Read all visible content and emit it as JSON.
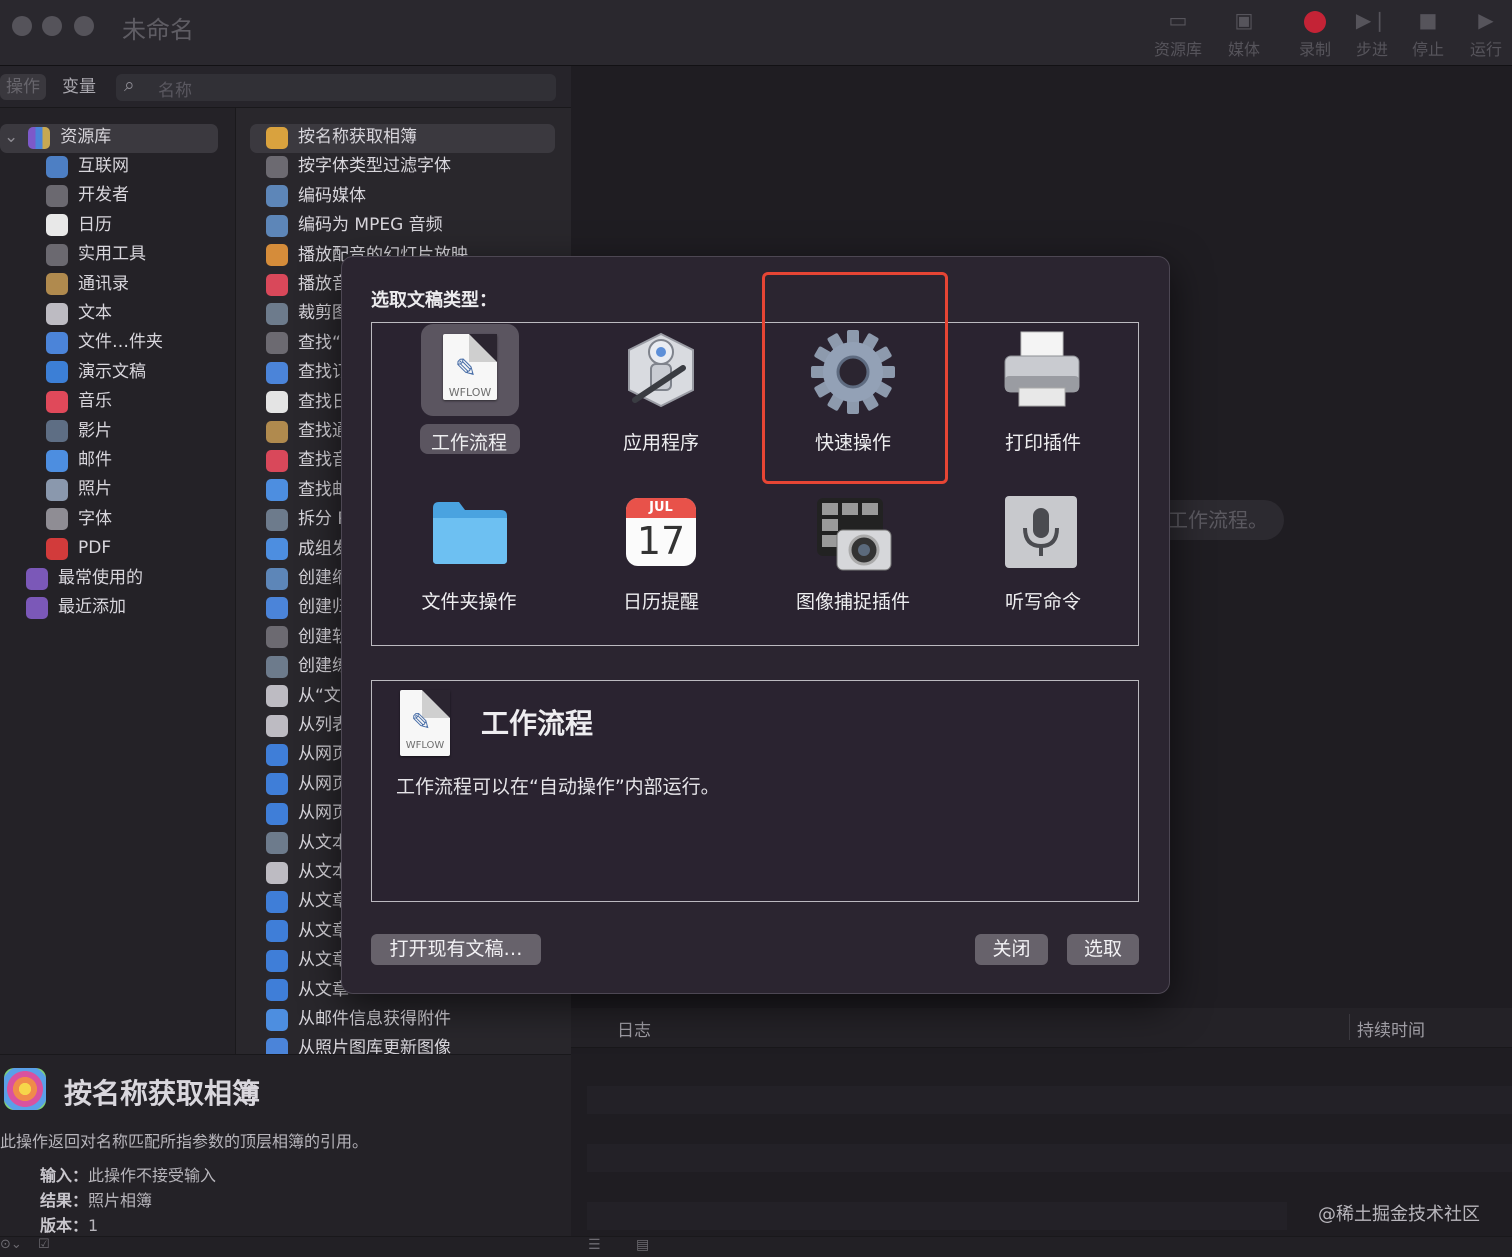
{
  "window": {
    "title": "未命名",
    "toolbar": [
      "资源库",
      "媒体",
      "录制",
      "步进",
      "停止",
      "运行"
    ],
    "colors": {
      "record": "#d7263d",
      "highlight": "#e64534"
    }
  },
  "left_tabs": {
    "actions": "操作",
    "variables": "变量",
    "search_placeholder": "名称"
  },
  "library": {
    "root": "资源库",
    "items": [
      "互联网",
      "开发者",
      "日历",
      "实用工具",
      "通讯录",
      "文本",
      "文件…件夹",
      "演示文稿",
      "音乐",
      "影片",
      "邮件",
      "照片",
      "字体",
      "PDF"
    ],
    "smart": [
      "最常使用的",
      "最近添加"
    ],
    "calendar_badge": "17"
  },
  "actions_list": [
    "按名称获取相簿",
    "按字体类型过滤字体",
    "编码媒体",
    "编码为 MPEG 音频",
    "播放配音的幻灯片放映",
    "播放音",
    "裁剪图",
    "查找“",
    "查找订",
    "查找日",
    "查找通",
    "查找音",
    "查找邮",
    "拆分 P",
    "成组发",
    "创建缩",
    "创建归",
    "创建软",
    "创建练",
    "从“文",
    "从列表",
    "从网页",
    "从网页",
    "从网页",
    "从文本",
    "从文本",
    "从文章",
    "从文章",
    "从文章",
    "从文章",
    "从邮件信息获得附件",
    "从照片图库更新图像"
  ],
  "info": {
    "title": "按名称获取相簿",
    "description": "此操作返回对名称匹配所指参数的顶层相簿的引用。",
    "input_label": "输入：",
    "input_value": "此操作不接受输入",
    "result_label": "结果：",
    "result_value": "照片相簿",
    "version_label": "版本：",
    "version_value": "1"
  },
  "canvas": {
    "hint": "工作流程。"
  },
  "log": {
    "col_log": "日志",
    "col_duration": "持续时间"
  },
  "watermark": "@稀土掘金技术社区",
  "dialog": {
    "title": "选取文稿类型：",
    "types": [
      {
        "label": "工作流程",
        "icon": "workflow-doc-icon",
        "badge": "WFLOW",
        "selected": true
      },
      {
        "label": "应用程序",
        "icon": "automator-robot-icon"
      },
      {
        "label": "快速操作",
        "icon": "gear-icon"
      },
      {
        "label": "打印插件",
        "icon": "printer-icon"
      },
      {
        "label": "文件夹操作",
        "icon": "folder-icon"
      },
      {
        "label": "日历提醒",
        "icon": "calendar-icon",
        "month": "JUL",
        "day": "17"
      },
      {
        "label": "图像捕捉插件",
        "icon": "camera-icon"
      },
      {
        "label": "听写命令",
        "icon": "microphone-icon"
      }
    ],
    "detail": {
      "title": "工作流程",
      "badge": "WFLOW",
      "text": "工作流程可以在“自动操作”内部运行。"
    },
    "open_existing": "打开现有文稿…",
    "close": "关闭",
    "choose": "选取"
  }
}
